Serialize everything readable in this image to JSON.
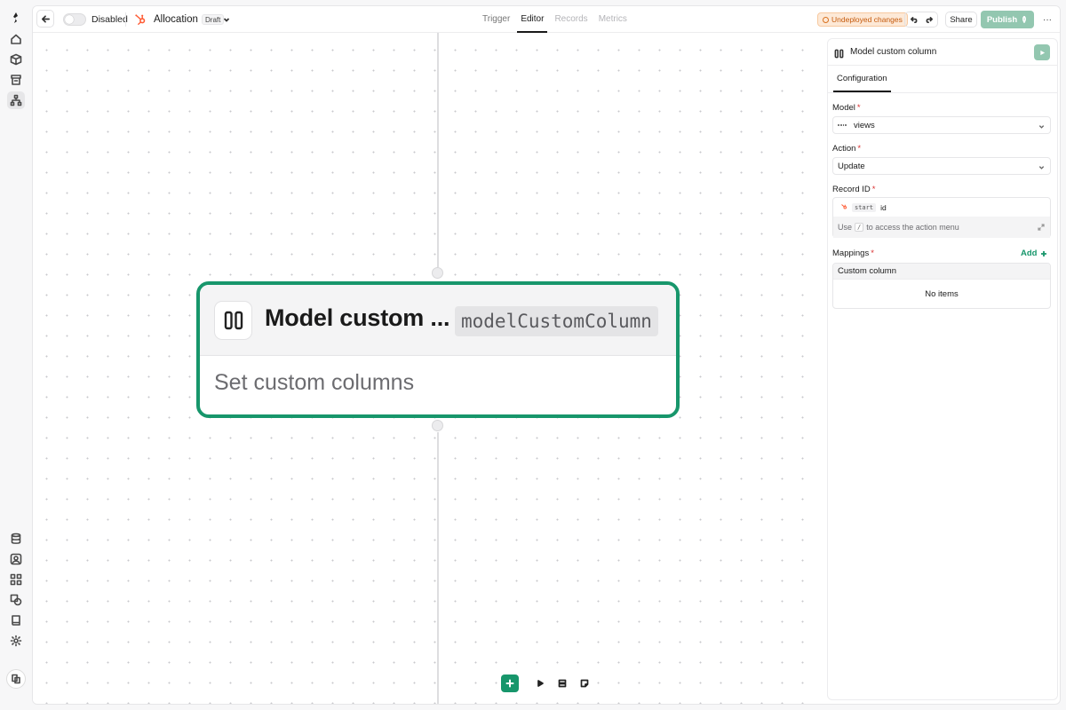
{
  "app": {
    "toggle_label": "Disabled",
    "title": "Allocation",
    "status": "Draft",
    "tabs": [
      {
        "label": "Trigger",
        "state": "normal"
      },
      {
        "label": "Editor",
        "state": "active"
      },
      {
        "label": "Records",
        "state": "disabled"
      },
      {
        "label": "Metrics",
        "state": "disabled"
      }
    ],
    "undeployed_label": "Undeployed changes",
    "share_label": "Share",
    "publish_label": "Publish",
    "more_label": "···"
  },
  "rail": {
    "top_icons": [
      "logo-icon",
      "home-icon",
      "box-icon",
      "archive-icon",
      "workflow-icon"
    ],
    "bottom_icons": [
      "database-icon",
      "user-card-icon",
      "apps-grid-icon",
      "shapes-icon",
      "book-icon",
      "settings-icon"
    ],
    "workspace_icon": "workspace-icon"
  },
  "node": {
    "title": "Model custom ...",
    "key": "modelCustomColumn",
    "description": "Set custom columns"
  },
  "panel": {
    "title": "Model custom column",
    "tab": "Configuration",
    "model": {
      "label": "Model",
      "value": "views"
    },
    "action": {
      "label": "Action",
      "value": "Update"
    },
    "record_id": {
      "label": "Record ID",
      "chip": "start",
      "value": "id",
      "hint_prefix": "Use",
      "hint_key": "/",
      "hint_suffix": "to access the action menu"
    },
    "mappings": {
      "label": "Mappings",
      "add_label": "Add",
      "column_header": "Custom column",
      "empty_text": "No items"
    }
  },
  "colors": {
    "accent": "#17966b",
    "accent_light": "#93c7b0",
    "warning_bg": "#fde9d7",
    "warning_text": "#c55a0c",
    "required": "#d93030"
  }
}
